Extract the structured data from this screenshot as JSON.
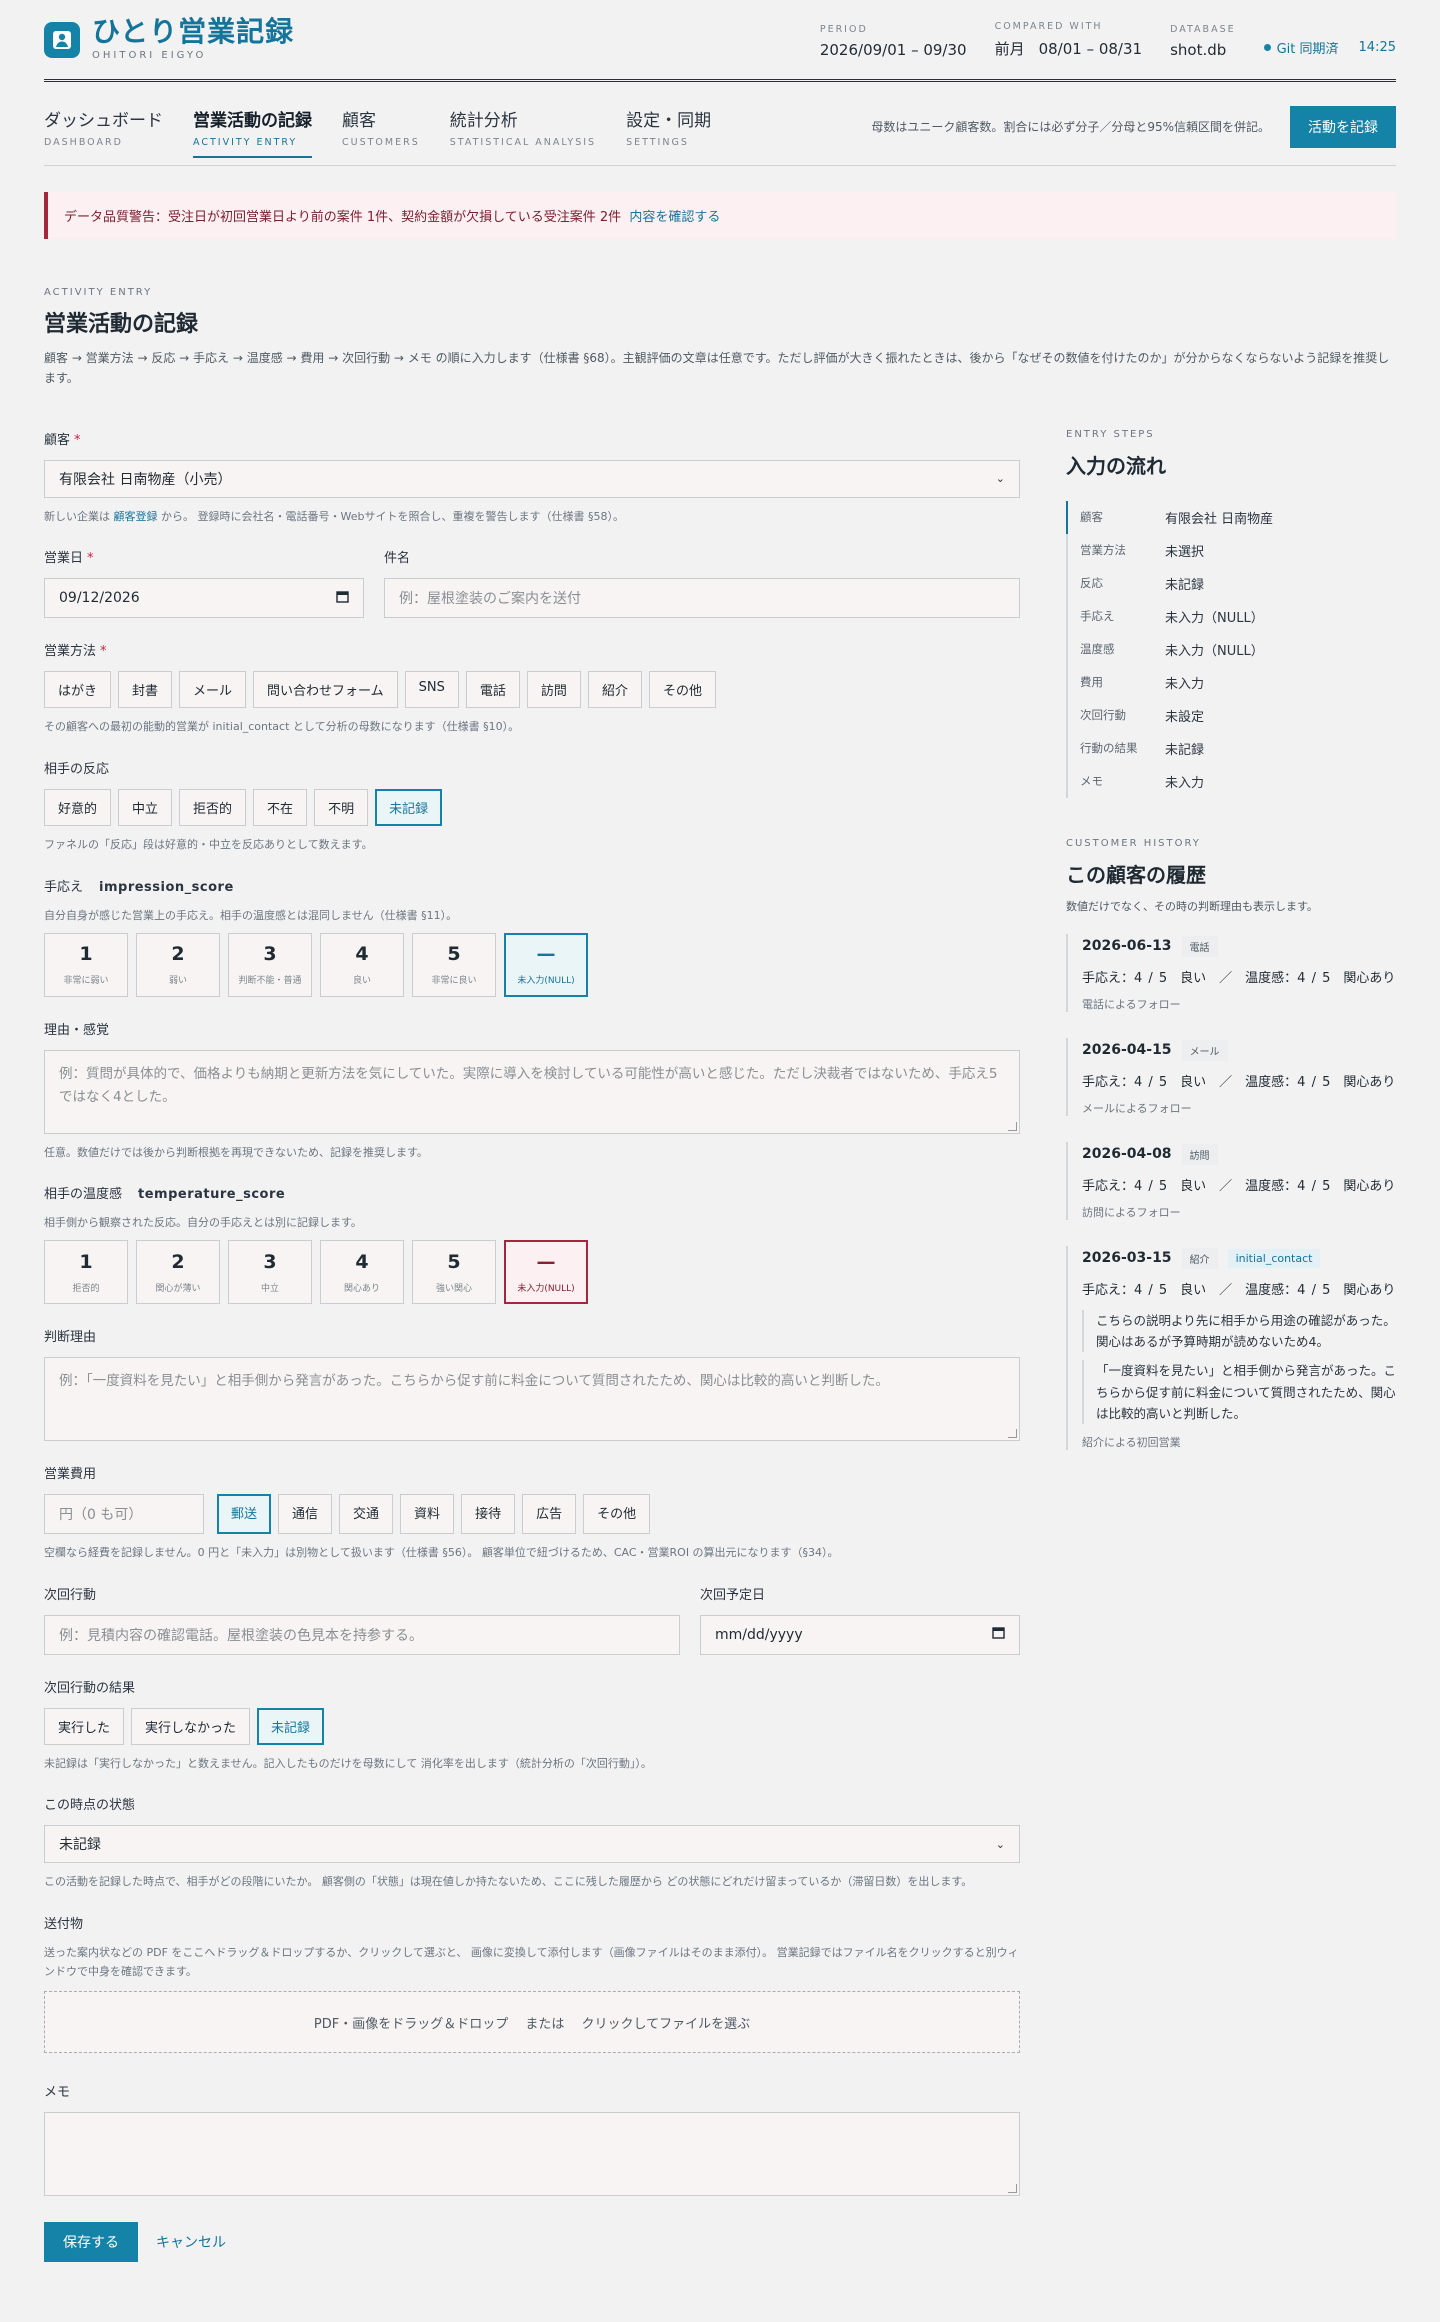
{
  "header": {
    "brand_name": "ひとり営業記録",
    "brand_sub": "OHITORI EIGYO",
    "period_label": "PERIOD",
    "period_value": "2026/09/01 – 09/30",
    "compared_label": "COMPARED WITH",
    "compared_prefix": "前月",
    "compared_value": "08/01 – 08/31",
    "database_label": "DATABASE",
    "database_value": "shot.db",
    "sync_status": "Git 同期済",
    "sync_time": "14:25"
  },
  "nav": {
    "tabs": [
      {
        "jp": "ダッシュボード",
        "en": "DASHBOARD"
      },
      {
        "jp": "営業活動の記録",
        "en": "ACTIVITY ENTRY"
      },
      {
        "jp": "顧客",
        "en": "CUSTOMERS"
      },
      {
        "jp": "統計分析",
        "en": "STATISTICAL ANALYSIS"
      },
      {
        "jp": "設定・同期",
        "en": "SETTINGS"
      }
    ],
    "note": "母数はユニーク顧客数。割合には必ず分子／分母と95%信頼区間を併記。",
    "record_button": "活動を記録"
  },
  "warning": {
    "text": "データ品質警告：受注日が初回営業日より前の案件 1件、契約金額が欠損している受注案件 2件",
    "link": "内容を確認する"
  },
  "section": {
    "label": "ACTIVITY ENTRY",
    "title": "営業活動の記録",
    "desc": "顧客 → 営業方法 → 反応 → 手応え → 温度感 → 費用 → 次回行動 → メモ の順に入力します（仕様書 §68）。主観評価の文章は任意です。ただし評価が大きく振れたときは、後から「なぜその数値を付けたのか」が分からなくならないよう記録を推奨します。"
  },
  "form": {
    "customer": {
      "label": "顧客",
      "value": "有限会社 日南物産（小売）",
      "help_pre": "新しい企業は",
      "help_link": "顧客登録",
      "help_post": "から。 登録時に会社名・電話番号・Webサイトを照合し、重複を警告します（仕様書 §58）。"
    },
    "date": {
      "label": "営業日",
      "value": "09/12/2026"
    },
    "subject": {
      "label": "件名",
      "placeholder": "例：屋根塗装のご案内を送付"
    },
    "method": {
      "label": "営業方法",
      "options": [
        "はがき",
        "封書",
        "メール",
        "問い合わせフォーム",
        "SNS",
        "電話",
        "訪問",
        "紹介",
        "その他"
      ],
      "help": "その顧客への最初の能動的営業が initial_contact として分析の母数になります（仕様書 §10）。"
    },
    "reaction": {
      "label": "相手の反応",
      "options": [
        "好意的",
        "中立",
        "拒否的",
        "不在",
        "不明",
        "未記録"
      ],
      "help": "ファネルの「反応」段は好意的・中立を反応ありとして数えます。"
    },
    "impression": {
      "label": "手応え",
      "code": "impression_score",
      "sub": "自分自身が感じた営業上の手応え。相手の温度感とは混同しません（仕様書 §11）。",
      "options": [
        {
          "n": "1",
          "l": "非常に弱い"
        },
        {
          "n": "2",
          "l": "弱い"
        },
        {
          "n": "3",
          "l": "判断不能・普通"
        },
        {
          "n": "4",
          "l": "良い"
        },
        {
          "n": "5",
          "l": "非常に良い"
        },
        {
          "n": "—",
          "l": "未入力(NULL)"
        }
      ]
    },
    "impression_reason": {
      "label": "理由・感覚",
      "placeholder": "例：質問が具体的で、価格よりも納期と更新方法を気にしていた。実際に導入を検討している可能性が高いと感じた。ただし決裁者ではないため、手応え5ではなく4とした。",
      "help": "任意。数値だけでは後から判断根拠を再現できないため、記録を推奨します。"
    },
    "temperature": {
      "label": "相手の温度感",
      "code": "temperature_score",
      "sub": "相手側から観察された反応。自分の手応えとは別に記録します。",
      "options": [
        {
          "n": "1",
          "l": "拒否的"
        },
        {
          "n": "2",
          "l": "関心が薄い"
        },
        {
          "n": "3",
          "l": "中立"
        },
        {
          "n": "4",
          "l": "関心あり"
        },
        {
          "n": "5",
          "l": "強い関心"
        },
        {
          "n": "—",
          "l": "未入力(NULL)"
        }
      ]
    },
    "temperature_reason": {
      "label": "判断理由",
      "placeholder": "例：「一度資料を見たい」と相手側から発言があった。こちらから促す前に料金について質問されたため、関心は比較的高いと判断した。"
    },
    "cost": {
      "label": "営業費用",
      "placeholder": "円（0 も可）",
      "options": [
        "郵送",
        "通信",
        "交通",
        "資料",
        "接待",
        "広告",
        "その他"
      ],
      "help": "空欄なら経費を記録しません。0 円と「未入力」は別物として扱います（仕様書 §56）。 顧客単位で紐づけるため、CAC・営業ROI の算出元になります（§34）。"
    },
    "next_action": {
      "label": "次回行動",
      "placeholder": "例：見積内容の確認電話。屋根塗装の色見本を持参する。"
    },
    "next_date": {
      "label": "次回予定日",
      "placeholder": "mm/dd/yyyy"
    },
    "next_result": {
      "label": "次回行動の結果",
      "options": [
        "実行した",
        "実行しなかった",
        "未記録"
      ],
      "help": "未記録は「実行しなかった」と数えません。記入したものだけを母数にして 消化率を出します（統計分析の「次回行動」）。"
    },
    "state": {
      "label": "この時点の状態",
      "value": "未記録",
      "help": "この活動を記録した時点で、相手がどの段階にいたか。 顧客側の「状態」は現在値しか持たないため、ここに残した履歴から どの状態にどれだけ留まっているか（滞留日数）を出します。"
    },
    "attachment": {
      "label": "送付物",
      "sub": "送った案内状などの PDF をここへドラッグ＆ドロップするか、クリックして選ぶと、 画像に変換して添付します（画像ファイルはそのまま添付）。 営業記録ではファイル名をクリックすると別ウィンドウで中身を確認できます。",
      "dropzone": "PDF・画像をドラッグ＆ドロップ　 または　 クリックしてファイルを選ぶ"
    },
    "memo": {
      "label": "メモ"
    },
    "save": "保存する",
    "cancel": "キャンセル"
  },
  "side": {
    "steps_label": "ENTRY STEPS",
    "steps_title": "入力の流れ",
    "steps": [
      {
        "k": "顧客",
        "v": "有限会社 日南物産"
      },
      {
        "k": "営業方法",
        "v": "未選択"
      },
      {
        "k": "反応",
        "v": "未記録"
      },
      {
        "k": "手応え",
        "v": "未入力（NULL）"
      },
      {
        "k": "温度感",
        "v": "未入力（NULL）"
      },
      {
        "k": "費用",
        "v": "未入力"
      },
      {
        "k": "次回行動",
        "v": "未設定"
      },
      {
        "k": "行動の結果",
        "v": "未記録"
      },
      {
        "k": "メモ",
        "v": "未入力"
      }
    ],
    "history_label": "CUSTOMER HISTORY",
    "history_title": "この顧客の履歴",
    "history_desc": "数値だけでなく、その時の判断理由も表示します。",
    "history": [
      {
        "date": "2026-06-13",
        "tag": "電話",
        "tag2": "",
        "scores": "手応え：4 / 5　良い　／　温度感：4 / 5　関心あり",
        "reasons": [],
        "note": "電話によるフォロー"
      },
      {
        "date": "2026-04-15",
        "tag": "メール",
        "tag2": "",
        "scores": "手応え：4 / 5　良い　／　温度感：4 / 5　関心あり",
        "reasons": [],
        "note": "メールによるフォロー"
      },
      {
        "date": "2026-04-08",
        "tag": "訪問",
        "tag2": "",
        "scores": "手応え：4 / 5　良い　／　温度感：4 / 5　関心あり",
        "reasons": [],
        "note": "訪問によるフォロー"
      },
      {
        "date": "2026-03-15",
        "tag": "紹介",
        "tag2": "initial_contact",
        "scores": "手応え：4 / 5　良い　／　温度感：4 / 5　関心あり",
        "reasons": [
          "こちらの説明より先に相手から用途の確認があった。関心はあるが予算時期が読めないため4。",
          "「一度資料を見たい」と相手側から発言があった。こちらから促す前に料金について質問されたため、関心は比較的高いと判断した。"
        ],
        "note": "紹介による初回営業"
      }
    ]
  },
  "colors": {
    "accent": "#1583a8",
    "warning": "#a3283d"
  }
}
